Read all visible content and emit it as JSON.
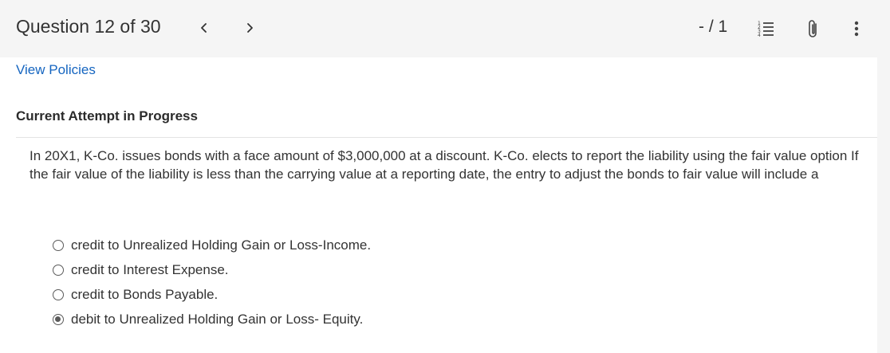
{
  "header": {
    "question_title": "Question 12 of 30",
    "prev_symbol": "<",
    "next_symbol": ">",
    "score": "- / 1",
    "icons": [
      "list-icon",
      "attachment-icon",
      "more-vertical-icon"
    ]
  },
  "links": {
    "view_policies": "View Policies"
  },
  "attempt": {
    "heading": "Current Attempt in Progress"
  },
  "question": {
    "text": "In 20X1, K-Co. issues bonds with a face amount of $3,000,000 at a discount. K-Co. elects to report the liability using the fair value option If the fair value of the liability is less than the carrying value at a reporting date, the entry to adjust the bonds to fair value will include a"
  },
  "options": [
    {
      "label": "credit to Unrealized Holding Gain or Loss-Income.",
      "selected": false
    },
    {
      "label": "credit to Interest Expense.",
      "selected": false
    },
    {
      "label": "credit to Bonds Payable.",
      "selected": false
    },
    {
      "label": "debit to Unrealized Holding Gain or Loss- Equity.",
      "selected": true
    }
  ],
  "colors": {
    "link": "#1565c0",
    "background": "#f5f5f5",
    "panel": "#ffffff"
  }
}
